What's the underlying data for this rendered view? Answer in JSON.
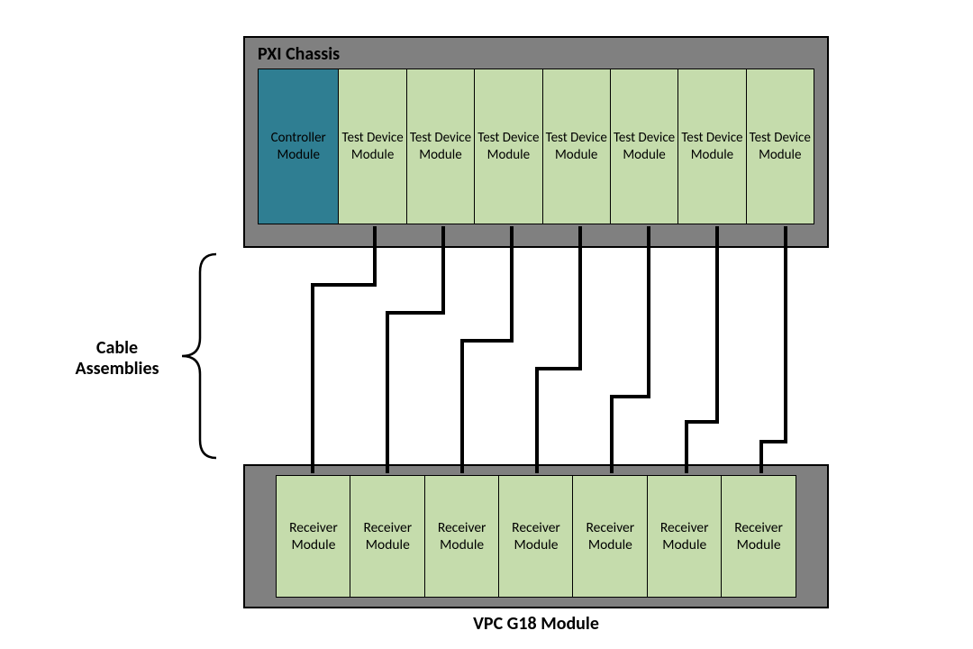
{
  "top_chassis": {
    "title": "PXI Chassis",
    "controller_label": "Controller Module",
    "test_label": "Test Device Module",
    "test_count": 7
  },
  "bottom_chassis": {
    "title": "VPC G18 Module",
    "receiver_label": "Receiver Module",
    "receiver_count": 7
  },
  "cable_label": "Cable Assemblies"
}
